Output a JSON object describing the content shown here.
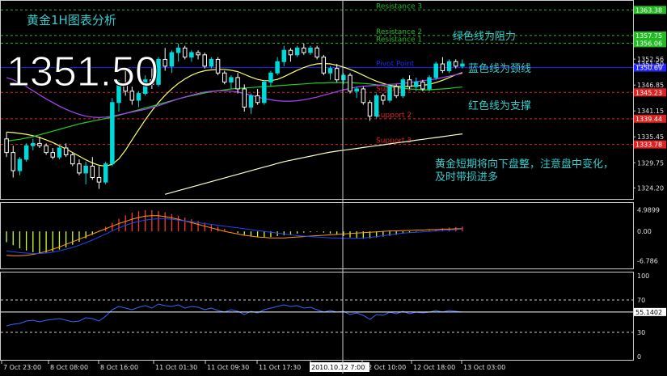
{
  "chart_data": {
    "type": "candlestick",
    "title": "黄金1H图表分析",
    "big_price": "1351.50",
    "colors": {
      "background": "#000000",
      "bull": "#00d9d9",
      "bear": "#ffffff",
      "resistance": "#22bb22",
      "support": "#dd2222",
      "pivot": "#2222ff",
      "ma_fast": "#ffff66",
      "ma_mid": "#22cc22",
      "ma_slow": "#aa44ff",
      "ma_long": "#ffffcc",
      "macd_line": "#2244ff",
      "signal_line": "#ff9900",
      "rsi": "#3366ff",
      "annotation": "#33cccc"
    },
    "price_axis": {
      "ylim": [
        1322.5,
        1364.5
      ],
      "ticks": [
        1363.38,
        1357.75,
        1356.06,
        1352.56,
        1351.5,
        1350.69,
        1346.85,
        1345.23,
        1341.15,
        1339.44,
        1335.45,
        1333.78,
        1329.75,
        1324.2
      ],
      "badges": [
        {
          "value": "1363.38",
          "price": 1363.38,
          "color": "#22bb22"
        },
        {
          "value": "1357.75",
          "price": 1357.75,
          "color": "#22bb22"
        },
        {
          "value": "1356.06",
          "price": 1356.06,
          "color": "#22bb22"
        },
        {
          "value": "1350.69",
          "price": 1350.69,
          "color": "#2222ff"
        },
        {
          "value": "1345.23",
          "price": 1345.23,
          "color": "#dd2222"
        },
        {
          "value": "1339.44",
          "price": 1339.44,
          "color": "#dd2222"
        },
        {
          "value": "1333.78",
          "price": 1333.78,
          "color": "#dd2222"
        }
      ],
      "plain_ticks": [
        "1352.56",
        "1351.50",
        "1346.85",
        "1341.15",
        "1335.45",
        "1329.75",
        "1324.20"
      ]
    },
    "levels": [
      {
        "name": "Resistance 3",
        "price": 1363.38,
        "kind": "resistance"
      },
      {
        "name": "Resistance 2",
        "price": 1357.75,
        "kind": "resistance"
      },
      {
        "name": "Resistance 1",
        "price": 1356.06,
        "kind": "resistance"
      },
      {
        "name": "Pivot Point",
        "price": 1350.69,
        "kind": "pivot"
      },
      {
        "name": "Support 1",
        "price": 1345.23,
        "kind": "support"
      },
      {
        "name": "Support 2",
        "price": 1339.44,
        "kind": "support"
      },
      {
        "name": "Support 3",
        "price": 1333.78,
        "kind": "support"
      }
    ],
    "candles": [
      [
        1335.0,
        1336.5,
        1331.0,
        1332.0
      ],
      [
        1332.0,
        1333.5,
        1326.5,
        1328.0
      ],
      [
        1328.0,
        1331.0,
        1327.0,
        1330.5
      ],
      [
        1330.5,
        1334.0,
        1330.0,
        1333.5
      ],
      [
        1333.5,
        1335.0,
        1332.5,
        1334.0
      ],
      [
        1334.0,
        1335.5,
        1333.0,
        1333.5
      ],
      [
        1333.5,
        1334.0,
        1331.5,
        1332.0
      ],
      [
        1332.0,
        1333.0,
        1330.5,
        1331.0
      ],
      [
        1331.0,
        1333.5,
        1330.5,
        1333.0
      ],
      [
        1333.0,
        1334.0,
        1331.0,
        1331.5
      ],
      [
        1331.5,
        1332.0,
        1329.0,
        1329.5
      ],
      [
        1329.5,
        1330.5,
        1327.0,
        1327.5
      ],
      [
        1327.5,
        1330.0,
        1325.0,
        1329.0
      ],
      [
        1329.0,
        1331.0,
        1326.0,
        1326.5
      ],
      [
        1326.5,
        1329.0,
        1324.0,
        1325.5
      ],
      [
        1325.5,
        1330.0,
        1325.0,
        1329.5
      ],
      [
        1329.5,
        1344.0,
        1329.0,
        1343.0
      ],
      [
        1343.0,
        1348.0,
        1341.0,
        1347.0
      ],
      [
        1347.0,
        1350.0,
        1344.5,
        1345.5
      ],
      [
        1345.5,
        1346.5,
        1342.5,
        1343.5
      ],
      [
        1343.5,
        1345.5,
        1342.0,
        1345.0
      ],
      [
        1345.0,
        1349.0,
        1344.5,
        1348.0
      ],
      [
        1348.0,
        1350.5,
        1346.0,
        1347.0
      ],
      [
        1347.0,
        1353.0,
        1346.5,
        1352.5
      ],
      [
        1352.5,
        1355.0,
        1350.0,
        1351.0
      ],
      [
        1351.0,
        1354.5,
        1349.5,
        1354.0
      ],
      [
        1354.0,
        1356.0,
        1352.0,
        1355.0
      ],
      [
        1355.0,
        1355.5,
        1352.5,
        1353.0
      ],
      [
        1353.0,
        1354.5,
        1352.0,
        1354.0
      ],
      [
        1354.0,
        1354.5,
        1352.5,
        1353.5
      ],
      [
        1353.5,
        1354.0,
        1350.5,
        1351.0
      ],
      [
        1351.0,
        1353.0,
        1350.5,
        1352.5
      ],
      [
        1352.5,
        1353.0,
        1349.0,
        1349.5
      ],
      [
        1349.5,
        1350.0,
        1347.0,
        1347.5
      ],
      [
        1347.5,
        1349.0,
        1346.0,
        1348.5
      ],
      [
        1348.5,
        1349.5,
        1345.0,
        1346.0
      ],
      [
        1346.0,
        1347.0,
        1341.0,
        1342.0
      ],
      [
        1342.0,
        1345.0,
        1340.5,
        1344.5
      ],
      [
        1344.5,
        1346.0,
        1342.5,
        1343.0
      ],
      [
        1343.0,
        1348.0,
        1342.5,
        1347.5
      ],
      [
        1347.5,
        1350.0,
        1346.5,
        1349.5
      ],
      [
        1349.5,
        1353.0,
        1349.0,
        1352.0
      ],
      [
        1352.0,
        1355.5,
        1351.0,
        1354.5
      ],
      [
        1354.5,
        1355.0,
        1352.0,
        1353.5
      ],
      [
        1353.5,
        1355.5,
        1353.0,
        1355.0
      ],
      [
        1355.0,
        1356.0,
        1353.5,
        1354.0
      ],
      [
        1354.0,
        1355.5,
        1353.5,
        1355.0
      ],
      [
        1355.0,
        1355.5,
        1352.5,
        1353.0
      ],
      [
        1353.0,
        1353.5,
        1349.0,
        1349.5
      ],
      [
        1349.5,
        1351.0,
        1348.0,
        1350.5
      ],
      [
        1350.5,
        1351.5,
        1347.5,
        1348.0
      ],
      [
        1348.0,
        1349.5,
        1347.0,
        1349.0
      ],
      [
        1349.0,
        1349.5,
        1345.0,
        1345.5
      ],
      [
        1345.5,
        1346.5,
        1344.0,
        1346.0
      ],
      [
        1346.0,
        1346.5,
        1342.5,
        1343.0
      ],
      [
        1343.0,
        1343.5,
        1339.0,
        1340.0
      ],
      [
        1340.0,
        1345.0,
        1339.5,
        1344.5
      ],
      [
        1344.5,
        1345.0,
        1342.5,
        1343.5
      ],
      [
        1343.5,
        1347.0,
        1343.0,
        1346.5
      ],
      [
        1346.5,
        1347.0,
        1344.0,
        1344.5
      ],
      [
        1344.5,
        1348.5,
        1344.0,
        1348.0
      ],
      [
        1348.0,
        1349.0,
        1346.0,
        1346.5
      ],
      [
        1346.5,
        1348.5,
        1345.5,
        1347.5
      ],
      [
        1347.5,
        1348.0,
        1345.5,
        1346.0
      ],
      [
        1346.0,
        1349.0,
        1345.5,
        1348.5
      ],
      [
        1348.5,
        1352.0,
        1348.0,
        1351.5
      ],
      [
        1351.5,
        1353.0,
        1349.5,
        1350.0
      ],
      [
        1350.0,
        1352.5,
        1349.5,
        1352.0
      ],
      [
        1352.0,
        1352.5,
        1350.5,
        1351.0
      ],
      [
        1351.0,
        1352.5,
        1350.5,
        1351.5
      ]
    ],
    "moving_averages": [
      {
        "key": "ma_fast",
        "values": [
          1336.5,
          1336.4,
          1336.2,
          1336.0,
          1335.7,
          1335.3,
          1334.8,
          1334.2,
          1333.5,
          1332.8,
          1332.0,
          1331.2,
          1330.4,
          1329.7,
          1329.2,
          1329.0,
          1329.4,
          1330.6,
          1332.5,
          1334.8,
          1337.0,
          1339.2,
          1341.2,
          1343.0,
          1344.6,
          1346.0,
          1347.2,
          1348.2,
          1349.0,
          1349.6,
          1350.0,
          1350.2,
          1350.3,
          1350.3,
          1350.1,
          1349.8,
          1349.2,
          1348.6,
          1348.1,
          1347.8,
          1347.8,
          1348.1,
          1348.7,
          1349.4,
          1350.1,
          1350.7,
          1351.2,
          1351.5,
          1351.6,
          1351.5,
          1351.2,
          1350.8,
          1350.3,
          1349.7,
          1349.0,
          1348.3,
          1347.7,
          1347.2,
          1346.8,
          1346.6,
          1346.5,
          1346.6,
          1346.7,
          1346.8,
          1347.0,
          1347.4,
          1347.9,
          1348.5,
          1349.1,
          1349.6
        ]
      },
      {
        "key": "ma_mid",
        "values": [
          1334.5,
          1334.7,
          1334.9,
          1335.2,
          1335.5,
          1335.9,
          1336.3,
          1336.7,
          1337.1,
          1337.5,
          1337.9,
          1338.3,
          1338.6,
          1338.9,
          1339.2,
          1339.5,
          1339.8,
          1340.2,
          1340.6,
          1341.0,
          1341.4,
          1341.8,
          1342.2,
          1342.6,
          1343.0,
          1343.4,
          1343.8,
          1344.2,
          1344.5,
          1344.8,
          1345.1,
          1345.4,
          1345.6,
          1345.8,
          1346.0,
          1346.1,
          1346.2,
          1346.3,
          1346.4,
          1346.5,
          1346.6,
          1346.7,
          1346.8,
          1346.9,
          1347.0,
          1347.1,
          1347.2,
          1347.3,
          1347.3,
          1347.4,
          1347.4,
          1347.4,
          1347.4,
          1347.3,
          1347.2,
          1347.1,
          1346.9,
          1346.7,
          1346.5,
          1346.3,
          1346.1,
          1346.0,
          1345.9,
          1345.8,
          1345.8,
          1345.9,
          1346.0,
          1346.1,
          1346.3,
          1346.4
        ]
      },
      {
        "key": "ma_slow",
        "values": [
          1348.5,
          1348.0,
          1347.3,
          1346.5,
          1345.6,
          1344.7,
          1343.8,
          1343.0,
          1342.2,
          1341.5,
          1340.9,
          1340.4,
          1340.0,
          1339.8,
          1339.7,
          1339.8,
          1340.0,
          1340.3,
          1340.6,
          1340.9,
          1341.2,
          1341.5,
          1341.9,
          1342.3,
          1342.8,
          1343.3,
          1343.8,
          1344.2,
          1344.6,
          1345.0,
          1345.3,
          1345.5,
          1345.6,
          1345.6,
          1345.5,
          1345.3,
          1345.0,
          1344.6,
          1344.2,
          1343.9,
          1343.6,
          1343.4,
          1343.3,
          1343.3,
          1343.4,
          1343.6,
          1343.9,
          1344.2,
          1344.6,
          1345.0,
          1345.4,
          1345.8,
          1346.1,
          1346.4,
          1346.6,
          1346.7,
          1346.8,
          1346.9,
          1347.0,
          1347.1,
          1347.2,
          1347.4,
          1347.6,
          1347.8,
          1348.0,
          1348.2,
          1348.5,
          1348.8,
          1349.1,
          1349.4
        ]
      },
      {
        "key": "ma_long",
        "values": [
          null,
          null,
          null,
          null,
          null,
          null,
          null,
          null,
          null,
          null,
          null,
          null,
          null,
          null,
          null,
          null,
          null,
          null,
          null,
          null,
          null,
          null,
          null,
          null,
          1322.8,
          1323.2,
          1323.6,
          1324.0,
          1324.4,
          1324.8,
          1325.2,
          1325.6,
          1326.0,
          1326.4,
          1326.8,
          1327.2,
          1327.6,
          1328.0,
          1328.4,
          1328.8,
          1329.2,
          1329.6,
          1330.0,
          1330.3,
          1330.6,
          1330.9,
          1331.2,
          1331.5,
          1331.8,
          1332.1,
          1332.3,
          1332.5,
          1332.7,
          1332.9,
          1333.1,
          1333.3,
          1333.5,
          1333.7,
          1333.9,
          1334.1,
          1334.3,
          1334.5,
          1334.7,
          1334.9,
          1335.1,
          1335.3,
          1335.5,
          1335.7,
          1335.9,
          1336.1
        ]
      }
    ],
    "macd": {
      "ylim": [
        -7.8,
        5.8
      ],
      "ticks": [
        "4.9899",
        "0.00",
        "-6.786"
      ],
      "tick_values": [
        4.9899,
        0.0,
        -6.786
      ],
      "hist": [
        -2.5,
        -3.2,
        -3.9,
        -4.4,
        -4.8,
        -5.0,
        -4.9,
        -4.6,
        -4.2,
        -3.7,
        -3.1,
        -2.4,
        -1.6,
        -0.8,
        0.2,
        1.1,
        2.0,
        2.9,
        3.7,
        4.3,
        4.7,
        4.9,
        4.9,
        4.7,
        4.4,
        4.0,
        3.6,
        3.2,
        2.8,
        2.4,
        2.0,
        1.6,
        1.1,
        0.6,
        0.1,
        -0.4,
        -0.8,
        -1.1,
        -1.3,
        -1.4,
        -1.3,
        -1.1,
        -0.9,
        -0.7,
        -0.5,
        -0.3,
        -0.2,
        -0.1,
        -0.3,
        -0.5,
        -0.8,
        -1.1,
        -1.4,
        -1.6,
        -1.7,
        -1.6,
        -1.4,
        -1.2,
        -1.0,
        -0.8,
        -0.5,
        -0.3,
        -0.1,
        0.1,
        0.3,
        0.5,
        0.7,
        0.9,
        1.0,
        1.1
      ],
      "line": [
        -4.5,
        -4.7,
        -4.9,
        -5.0,
        -5.1,
        -5.1,
        -5.0,
        -4.8,
        -4.5,
        -4.1,
        -3.7,
        -3.2,
        -2.6,
        -2.0,
        -1.3,
        -0.6,
        0.1,
        0.8,
        1.4,
        1.9,
        2.3,
        2.6,
        2.8,
        2.9,
        2.9,
        2.8,
        2.6,
        2.4,
        2.2,
        2.0,
        1.8,
        1.6,
        1.4,
        1.2,
        1.0,
        0.8,
        0.6,
        0.4,
        0.2,
        0.0,
        -0.2,
        -0.4,
        -0.6,
        -0.8,
        -1.0,
        -1.1,
        -1.2,
        -1.3,
        -1.4,
        -1.5,
        -1.5,
        -1.6,
        -1.6,
        -1.6,
        -1.5,
        -1.4,
        -1.2,
        -1.0,
        -0.8,
        -0.6,
        -0.4,
        -0.3,
        -0.2,
        -0.1,
        0.0,
        0.1,
        0.2,
        0.3,
        0.4,
        0.5
      ],
      "signal": [
        -5.5,
        -5.6,
        -5.6,
        -5.5,
        -5.3,
        -5.0,
        -4.6,
        -4.1,
        -3.6,
        -3.0,
        -2.4,
        -1.8,
        -1.2,
        -0.6,
        0.0,
        0.6,
        1.2,
        1.8,
        2.3,
        2.8,
        3.2,
        3.5,
        3.6,
        3.6,
        3.4,
        3.1,
        2.8,
        2.4,
        2.0,
        1.6,
        1.2,
        0.8,
        0.4,
        0.0,
        -0.3,
        -0.6,
        -0.9,
        -1.1,
        -1.3,
        -1.4,
        -1.5,
        -1.5,
        -1.5,
        -1.4,
        -1.3,
        -1.2,
        -1.1,
        -1.0,
        -0.9,
        -0.8,
        -0.7,
        -0.6,
        -0.5,
        -0.4,
        -0.3,
        -0.2,
        -0.1,
        0.0,
        0.1,
        0.1,
        0.2,
        0.2,
        0.3,
        0.3,
        0.4,
        0.4,
        0.5,
        0.5,
        0.6,
        0.6
      ]
    },
    "rsi": {
      "ylim": [
        0,
        100
      ],
      "ticks": [
        "100",
        "70",
        "55.1402",
        "30",
        "0"
      ],
      "tick_values": [
        100,
        70,
        55.1402,
        30,
        0
      ],
      "levels": [
        70,
        30
      ],
      "current": 55.1402,
      "values": [
        38,
        40,
        41,
        44,
        45,
        43,
        45,
        46,
        47,
        45,
        43,
        44,
        48,
        47,
        44,
        50,
        58,
        62,
        60,
        58,
        61,
        63,
        60,
        65,
        63,
        62,
        64,
        60,
        62,
        61,
        58,
        60,
        57,
        55,
        58,
        56,
        52,
        56,
        54,
        58,
        60,
        62,
        64,
        62,
        63,
        60,
        61,
        58,
        55,
        57,
        55,
        56,
        52,
        54,
        51,
        46,
        52,
        51,
        55,
        53,
        56,
        53,
        55,
        54,
        55,
        57,
        55,
        57,
        56,
        55
      ]
    },
    "x_labels": [
      "7 Oct 23:00",
      "8 Oct 08:00",
      "8 Oct 16:00",
      "11 Oct 01:30",
      "11 Oct 09:30",
      "11 Oct 17:30",
      "2010.10.12 7:00",
      "12 Oct 10:00",
      "12 Oct 18:00",
      "13 Oct 03:00"
    ],
    "annotations": [
      {
        "text": "绿色线为阻力"
      },
      {
        "text": "蓝色线为颈线"
      },
      {
        "text": "红色线为支撑"
      },
      {
        "text": "黄金短期将向下盘整，注意盘中变化，"
      },
      {
        "text": "及时带损进多"
      }
    ]
  }
}
